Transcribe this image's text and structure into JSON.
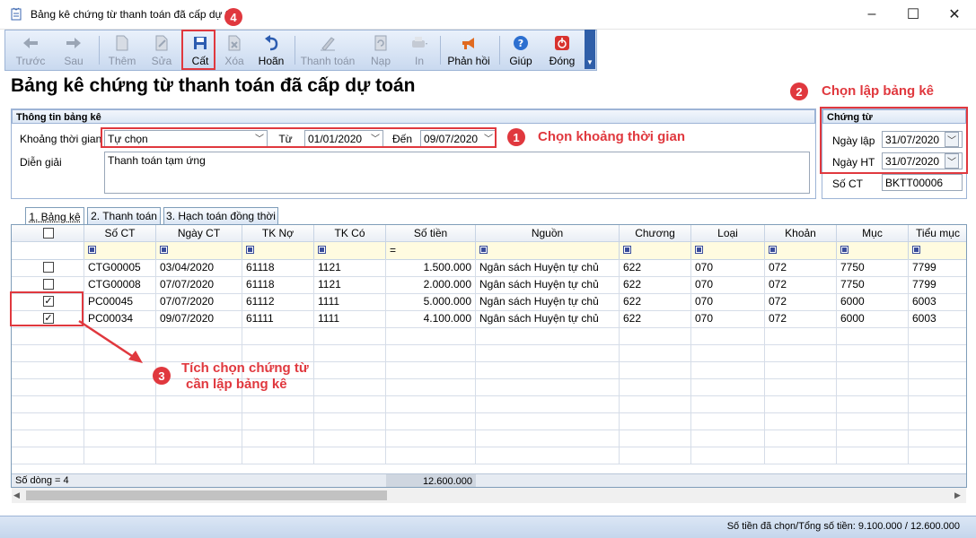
{
  "window": {
    "title": "Bảng kê chứng từ thanh toán đã cấp dự t",
    "minimize": "–",
    "maximize": "☐",
    "close": "✕"
  },
  "toolbar": {
    "items": [
      {
        "label": "Trước",
        "icon": "arrow-left-icon",
        "enabled": false
      },
      {
        "label": "Sau",
        "icon": "arrow-right-icon",
        "enabled": false
      },
      {
        "label": "Thêm",
        "icon": "new-document-icon",
        "enabled": false
      },
      {
        "label": "Sửa",
        "icon": "edit-document-icon",
        "enabled": false
      },
      {
        "label": "Cất",
        "icon": "save-icon",
        "enabled": true
      },
      {
        "label": "Xóa",
        "icon": "delete-icon",
        "enabled": false
      },
      {
        "label": "Hoãn",
        "icon": "undo-icon",
        "enabled": true
      },
      {
        "label": "Thanh toán",
        "icon": "pen-icon",
        "enabled": false
      },
      {
        "label": "Nạp",
        "icon": "refresh-icon",
        "enabled": false
      },
      {
        "label": "In",
        "icon": "printer-icon",
        "enabled": false
      },
      {
        "label": "Phản hồi",
        "icon": "megaphone-icon",
        "enabled": true
      },
      {
        "label": "Giúp",
        "icon": "help-icon",
        "enabled": true
      },
      {
        "label": "Đóng",
        "icon": "close-power-icon",
        "enabled": true
      }
    ]
  },
  "page": {
    "title": "Bảng kê chứng từ thanh toán đã cấp dự toán"
  },
  "info": {
    "header": "Thông tin bảng kê",
    "period_label": "Khoảng thời gian",
    "period_value": "Tự chọn",
    "from_label": "Từ",
    "from_value": "01/01/2020",
    "to_label": "Đến",
    "to_value": "09/07/2020",
    "desc_label": "Diễn giải",
    "desc_value": "Thanh toán tạm ứng"
  },
  "voucher": {
    "header": "Chứng từ",
    "date_label": "Ngày lập",
    "date_value": "31/07/2020",
    "post_label": "Ngày HT",
    "post_value": "31/07/2020",
    "no_label": "Số CT",
    "no_value": "BKTT00006"
  },
  "annotations": {
    "b1": "1",
    "t1": "Chọn khoảng thời gian",
    "b2": "2",
    "t2": "Chọn lập bảng kê",
    "b3": "3",
    "t3a": "Tích chọn chứng từ",
    "t3b": "cần lập bảng kê",
    "b4": "4"
  },
  "tabs": [
    "1. Bảng kê",
    "2. Thanh toán",
    "3. Hạch toán đồng thời"
  ],
  "grid": {
    "columns": [
      "Số CT",
      "Ngày CT",
      "TK Nợ",
      "TK Có",
      "Số tiền",
      "Nguồn",
      "Chương",
      "Loại",
      "Khoản",
      "Mục",
      "Tiểu mục"
    ],
    "amount_filter": "=",
    "rows": [
      {
        "checked": false,
        "cells": [
          "CTG00005",
          "03/04/2020",
          "61118",
          "1121",
          "1.500.000",
          "Ngân sách Huyện tự chủ",
          "622",
          "070",
          "072",
          "7750",
          "7799"
        ]
      },
      {
        "checked": false,
        "cells": [
          "CTG00008",
          "07/07/2020",
          "61118",
          "1121",
          "2.000.000",
          "Ngân sách Huyện tự chủ",
          "622",
          "070",
          "072",
          "7750",
          "7799"
        ]
      },
      {
        "checked": true,
        "cells": [
          "PC00045",
          "07/07/2020",
          "61112",
          "1111",
          "5.000.000",
          "Ngân sách Huyện tự chủ",
          "622",
          "070",
          "072",
          "6000",
          "6003"
        ]
      },
      {
        "checked": true,
        "cells": [
          "PC00034",
          "09/07/2020",
          "61111",
          "1111",
          "4.100.000",
          "Ngân sách Huyện tự chủ",
          "622",
          "070",
          "072",
          "6000",
          "6003"
        ]
      }
    ],
    "footer_count": "Số dòng = 4",
    "footer_total": "12.600.000"
  },
  "status": {
    "text": "Số tiền đã chọn/Tổng số tiền: 9.100.000 / 12.600.000"
  }
}
